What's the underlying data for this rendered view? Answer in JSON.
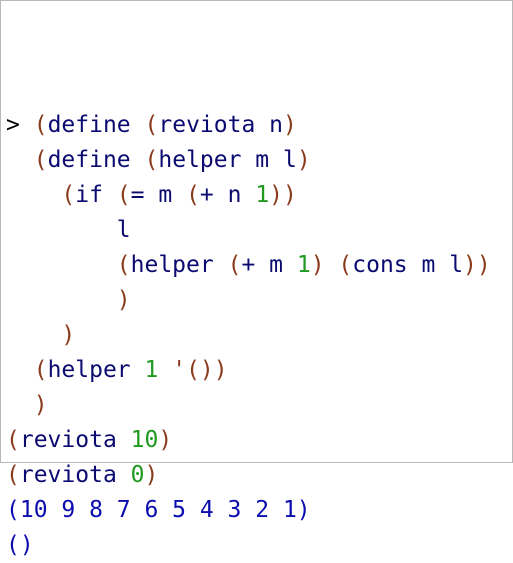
{
  "colors": {
    "paren": "#8b3b1d",
    "symbol": "#0a0a70",
    "number": "#1f9a1f",
    "prompt": "#000000",
    "output": "#0b0baf",
    "background": "#ffffff"
  },
  "repl": {
    "lines": [
      {
        "kind": "input",
        "tokens": [
          {
            "t": "> ",
            "c": "prompt"
          },
          {
            "t": "(",
            "c": "paren"
          },
          {
            "t": "define",
            "c": "sym"
          },
          {
            "t": " ",
            "c": "sym"
          },
          {
            "t": "(",
            "c": "paren"
          },
          {
            "t": "reviota n",
            "c": "sym"
          },
          {
            "t": ")",
            "c": "paren"
          }
        ]
      },
      {
        "kind": "input",
        "tokens": [
          {
            "t": "  ",
            "c": "sym"
          },
          {
            "t": "(",
            "c": "paren"
          },
          {
            "t": "define",
            "c": "sym"
          },
          {
            "t": " ",
            "c": "sym"
          },
          {
            "t": "(",
            "c": "paren"
          },
          {
            "t": "helper m l",
            "c": "sym"
          },
          {
            "t": ")",
            "c": "paren"
          }
        ]
      },
      {
        "kind": "input",
        "tokens": [
          {
            "t": "    ",
            "c": "sym"
          },
          {
            "t": "(",
            "c": "paren"
          },
          {
            "t": "if",
            "c": "sym"
          },
          {
            "t": " ",
            "c": "sym"
          },
          {
            "t": "(",
            "c": "paren"
          },
          {
            "t": "= m ",
            "c": "sym"
          },
          {
            "t": "(",
            "c": "paren"
          },
          {
            "t": "+ n ",
            "c": "sym"
          },
          {
            "t": "1",
            "c": "num"
          },
          {
            "t": "))",
            "c": "paren"
          }
        ]
      },
      {
        "kind": "input",
        "tokens": [
          {
            "t": "        l",
            "c": "sym"
          }
        ]
      },
      {
        "kind": "input",
        "tokens": [
          {
            "t": "        ",
            "c": "sym"
          },
          {
            "t": "(",
            "c": "paren"
          },
          {
            "t": "helper ",
            "c": "sym"
          },
          {
            "t": "(",
            "c": "paren"
          },
          {
            "t": "+ m ",
            "c": "sym"
          },
          {
            "t": "1",
            "c": "num"
          },
          {
            "t": ")",
            "c": "paren"
          },
          {
            "t": " ",
            "c": "sym"
          },
          {
            "t": "(",
            "c": "paren"
          },
          {
            "t": "cons m l",
            "c": "sym"
          },
          {
            "t": "))",
            "c": "paren"
          }
        ]
      },
      {
        "kind": "input",
        "tokens": [
          {
            "t": "        ",
            "c": "sym"
          },
          {
            "t": ")",
            "c": "paren"
          }
        ]
      },
      {
        "kind": "input",
        "tokens": [
          {
            "t": "    ",
            "c": "sym"
          },
          {
            "t": ")",
            "c": "paren"
          }
        ]
      },
      {
        "kind": "input",
        "tokens": [
          {
            "t": "  ",
            "c": "sym"
          },
          {
            "t": "(",
            "c": "paren"
          },
          {
            "t": "helper ",
            "c": "sym"
          },
          {
            "t": "1",
            "c": "num"
          },
          {
            "t": " ",
            "c": "sym"
          },
          {
            "t": "'()",
            "c": "quote"
          },
          {
            "t": ")",
            "c": "paren"
          }
        ]
      },
      {
        "kind": "input",
        "tokens": [
          {
            "t": "  ",
            "c": "sym"
          },
          {
            "t": ")",
            "c": "paren"
          }
        ]
      },
      {
        "kind": "input",
        "tokens": [
          {
            "t": "(",
            "c": "paren"
          },
          {
            "t": "reviota ",
            "c": "sym"
          },
          {
            "t": "10",
            "c": "num"
          },
          {
            "t": ")",
            "c": "paren"
          }
        ]
      },
      {
        "kind": "input",
        "tokens": [
          {
            "t": "(",
            "c": "paren"
          },
          {
            "t": "reviota ",
            "c": "sym"
          },
          {
            "t": "0",
            "c": "num"
          },
          {
            "t": ")",
            "c": "paren"
          }
        ]
      },
      {
        "kind": "output",
        "tokens": [
          {
            "t": "(10 9 8 7 6 5 4 3 2 1)",
            "c": "out"
          }
        ]
      },
      {
        "kind": "output",
        "tokens": [
          {
            "t": "()",
            "c": "out"
          }
        ]
      }
    ]
  }
}
